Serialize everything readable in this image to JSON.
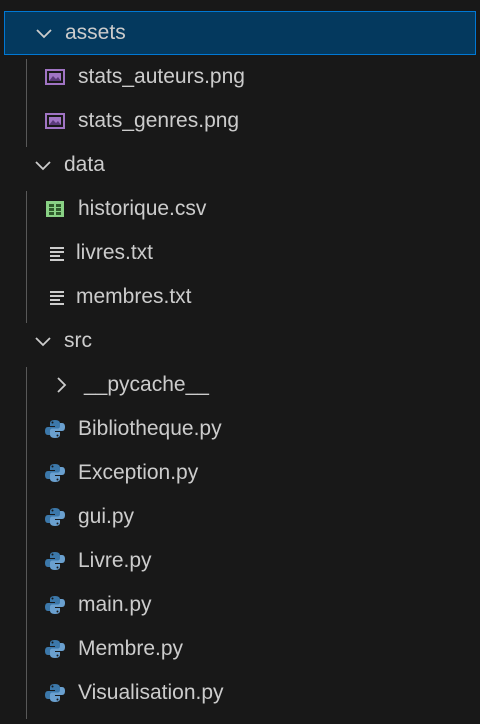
{
  "explorer": {
    "folders": [
      {
        "name": "assets",
        "expanded": true,
        "selected": true,
        "children": [
          {
            "name": "stats_auteurs.png",
            "icon": "image-file-icon"
          },
          {
            "name": "stats_genres.png",
            "icon": "image-file-icon"
          }
        ]
      },
      {
        "name": "data",
        "expanded": true,
        "selected": false,
        "children": [
          {
            "name": "historique.csv",
            "icon": "csv-file-icon"
          },
          {
            "name": "livres.txt",
            "icon": "text-file-icon"
          },
          {
            "name": "membres.txt",
            "icon": "text-file-icon"
          }
        ]
      },
      {
        "name": "src",
        "expanded": true,
        "selected": false,
        "children": [
          {
            "name": "__pycache__",
            "icon": "folder-collapsed",
            "collapsed": true
          },
          {
            "name": "Bibliotheque.py",
            "icon": "python-file-icon"
          },
          {
            "name": "Exception.py",
            "icon": "python-file-icon"
          },
          {
            "name": "gui.py",
            "icon": "python-file-icon"
          },
          {
            "name": "Livre.py",
            "icon": "python-file-icon"
          },
          {
            "name": "main.py",
            "icon": "python-file-icon"
          },
          {
            "name": "Membre.py",
            "icon": "python-file-icon"
          },
          {
            "name": "Visualisation.py",
            "icon": "python-file-icon"
          }
        ]
      }
    ]
  },
  "colors": {
    "background": "#181818",
    "text": "#cccccc",
    "selection_bg": "#04395e",
    "selection_border": "#0078d4",
    "image_icon": "#a074c4",
    "csv_icon": "#89d185",
    "python_icon_blue": "#3c78aa",
    "python_icon_light": "#6aa0cf"
  }
}
